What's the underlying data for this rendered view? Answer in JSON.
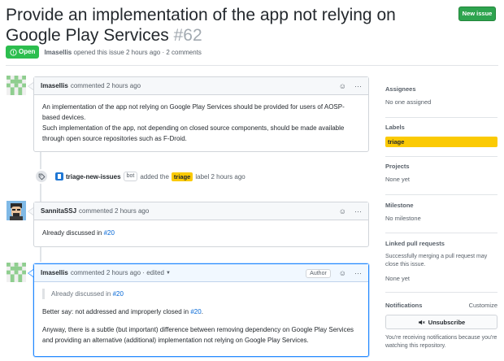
{
  "issue": {
    "title": "Provide an implementation of the app not relying on Google Play Services",
    "number": "#62",
    "state": "Open",
    "author": "lmasellis",
    "meta": "opened this issue 2 hours ago · 2 comments"
  },
  "header": {
    "new_issue_label": "New issue"
  },
  "comments": [
    {
      "author": "lmasellis",
      "time": "commented 2 hours ago",
      "paragraphs": [
        "An implementation of the app not relying on Google Play Services should be provided for users of AOSP-based devices.",
        "Such implementation of the app, not depending on closed source components, should be made available through open source repositories such as F-Droid."
      ]
    },
    {
      "author": "SannitaSSJ",
      "time": "commented 2 hours ago",
      "text_before": "Already discussed in ",
      "link": "#20"
    },
    {
      "author": "lmasellis",
      "time": "commented 2 hours ago · edited",
      "badge": "Author",
      "quote_before": "Already discussed in ",
      "quote_link": "#20",
      "line2_before": "Better say: not addressed and improperly closed in ",
      "line2_link": "#20",
      "line2_after": ".",
      "line3": "Anyway, there is a subtle (but important) difference between removing dependency on Google Play Services and providing an alternative (additional) implementation not relying on Google Play Services."
    }
  ],
  "event": {
    "actor": "triage-new-issues",
    "bot_badge": "bot",
    "action": "added the",
    "label": "triage",
    "suffix": "label 2 hours ago"
  },
  "sidebar": {
    "assignees": {
      "title": "Assignees",
      "value": "No one assigned"
    },
    "labels": {
      "title": "Labels",
      "label": "triage"
    },
    "projects": {
      "title": "Projects",
      "value": "None yet"
    },
    "milestone": {
      "title": "Milestone",
      "value": "No milestone"
    },
    "linked": {
      "title": "Linked pull requests",
      "value": "Successfully merging a pull request may close this issue.",
      "none": "None yet"
    },
    "notifications": {
      "title": "Notifications",
      "customize": "Customize",
      "button": "Unsubscribe",
      "note": "You're receiving notifications because you're watching this repository."
    }
  },
  "colors": {
    "open": "#2cbe4e",
    "label": "#fbca04",
    "link": "#0366d6"
  }
}
